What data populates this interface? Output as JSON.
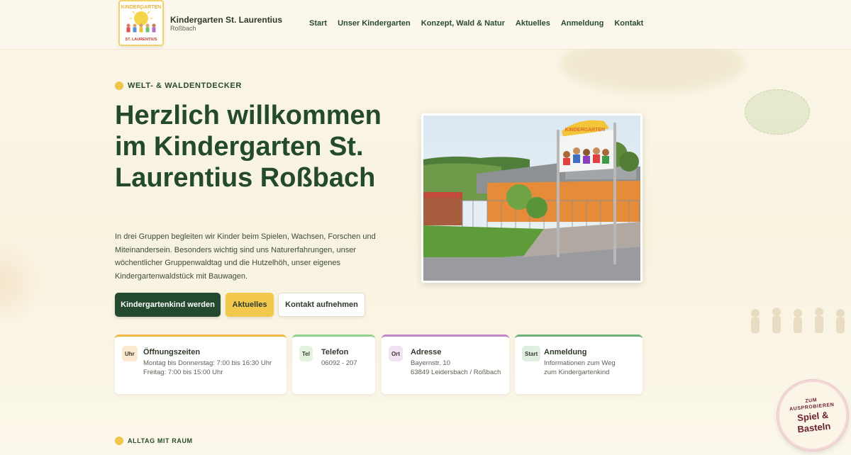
{
  "header": {
    "logo_top_text": "KINDERGARTEN",
    "logo_bottom_text": "ST. LAURENTIUS",
    "brand_name": "Kindergarten St. Laurentius",
    "brand_sub": "Roßbach",
    "nav": [
      "Start",
      "Unser Kindergarten",
      "Konzept, Wald & Natur",
      "Aktuelles",
      "Anmeldung",
      "Kontakt"
    ]
  },
  "hero": {
    "eyebrow": "WELT- & WALDENTDECKER",
    "title": "Herzlich willkommen im Kindergarten St. Laurentius Roßbach",
    "text": "In drei Gruppen begleiten wir Kinder beim Spielen, Wachsen, Forschen und Miteinandersein. Besonders wichtig sind uns Naturerfahrungen, unser wöchentlicher Gruppenwaldtag und die Hutzelhöh, unser eigenes Kindergartenwaldstück mit Bauwagen.",
    "buttons": {
      "primary": "Kindergartenkind werden",
      "secondary": "Aktuelles",
      "tertiary": "Kontakt aufnehmen"
    },
    "photo_sign": "KINDERGARTEN"
  },
  "cards": [
    {
      "tag": "Uhr",
      "title": "Öffnungszeiten",
      "lines": [
        "Montag bis Donnerstag: 7:00 bis 16:30 Uhr",
        "Freitag: 7:00 bis 15:00 Uhr"
      ]
    },
    {
      "tag": "Tel",
      "title": "Telefon",
      "lines": [
        "06092 - 207"
      ]
    },
    {
      "tag": "Ort",
      "title": "Adresse",
      "lines": [
        "Bayernstr. 10",
        "63849 Leidersbach / Roßbach"
      ]
    },
    {
      "tag": "Start",
      "title": "Anmeldung",
      "lines": [
        "Informationen zum Weg",
        "zum Kindergartenkind"
      ]
    }
  ],
  "section2": {
    "eyebrow": "ALLTAG MIT RAUM"
  },
  "badge": {
    "line1": "ZUM",
    "line2": "AUSPROBIEREN",
    "line3": "Spiel &",
    "line4": "Basteln"
  },
  "colors": {
    "primary_green": "#234a2f",
    "accent_yellow": "#f2c94c",
    "background": "#fbf6e9",
    "badge_text": "#6a1f2e"
  }
}
